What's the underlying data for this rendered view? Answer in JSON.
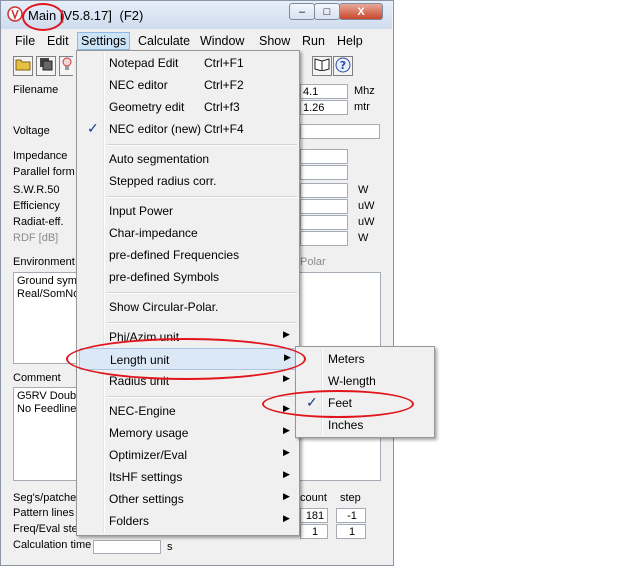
{
  "window": {
    "title": "Main",
    "version": "[V5.8.17]",
    "hotkey": "(F2)",
    "minimize": "–",
    "maximize": "□",
    "close": "X"
  },
  "menubar": [
    "File",
    "Edit",
    "Settings",
    "Calculate",
    "Window",
    "Show",
    "Run",
    "Help"
  ],
  "toolbar_icons": [
    "open-folder-icon",
    "save-copy-icon",
    "lamp-icon",
    "book-icon",
    "help-icon"
  ],
  "form": {
    "filename_label": "Filename",
    "freq_value": "4.1",
    "freq_unit": "Mhz",
    "wavelength_value": "1.26",
    "wavelength_unit": "mtr",
    "voltage_label": "Voltage",
    "impedance_label": "Impedance",
    "parallel_label": "Parallel form",
    "swr_label": "S.W.R.50",
    "efficiency_label": "Efficiency",
    "radiat_label": "Radiat-eff.",
    "rdf_label": "RDF [dB]",
    "unit_w1": "W",
    "unit_uw1": "uW",
    "unit_uw2": "uW",
    "unit_w2": "W",
    "environment_label": "Environment",
    "polar_label": "Polar",
    "env_lines": [
      "Ground symm",
      "Real/SomNo"
    ],
    "comment_label": "Comment",
    "comment_lines": [
      "G5RV Doub",
      "No Feedline"
    ],
    "segs_label": "Seg's/patches",
    "pattern_label": "Pattern lines",
    "freq_eval_label": "Freq/Eval ste",
    "calc_time_label": "Calculation time",
    "calc_time_unit": "s",
    "count_label": "count",
    "step_label": "step",
    "count_pattern": "181",
    "step_pattern": "-1",
    "count_freq": "1",
    "step_freq": "1"
  },
  "settings_menu": {
    "group1": [
      {
        "label": "Notepad Edit",
        "shortcut": "Ctrl+F1"
      },
      {
        "label": "NEC editor",
        "shortcut": "Ctrl+F2"
      },
      {
        "label": "Geometry edit",
        "shortcut": "Ctrl+f3"
      },
      {
        "label": "NEC editor (new)",
        "shortcut": "Ctrl+F4",
        "checked": true
      }
    ],
    "group2": [
      "Auto segmentation",
      "Stepped radius corr."
    ],
    "group3": [
      "Input Power",
      "Char-impedance",
      "pre-defined Frequencies",
      "pre-defined Symbols"
    ],
    "group4": [
      "Show Circular-Polar."
    ],
    "group5": [
      "Phi/Azim unit",
      "Length unit",
      "Radius unit"
    ],
    "group6": [
      "NEC-Engine",
      "Memory usage",
      "Optimizer/Eval",
      "ItsHF settings",
      "Other settings",
      "Folders"
    ]
  },
  "length_submenu": [
    "Meters",
    "W-length",
    "Feet",
    "Inches"
  ],
  "check_glyph": "✓",
  "arrow_glyph": "▶",
  "colors": {
    "annotation": "#e0161c",
    "highlight": "#dbe8f6",
    "check": "#1a3c8a"
  }
}
